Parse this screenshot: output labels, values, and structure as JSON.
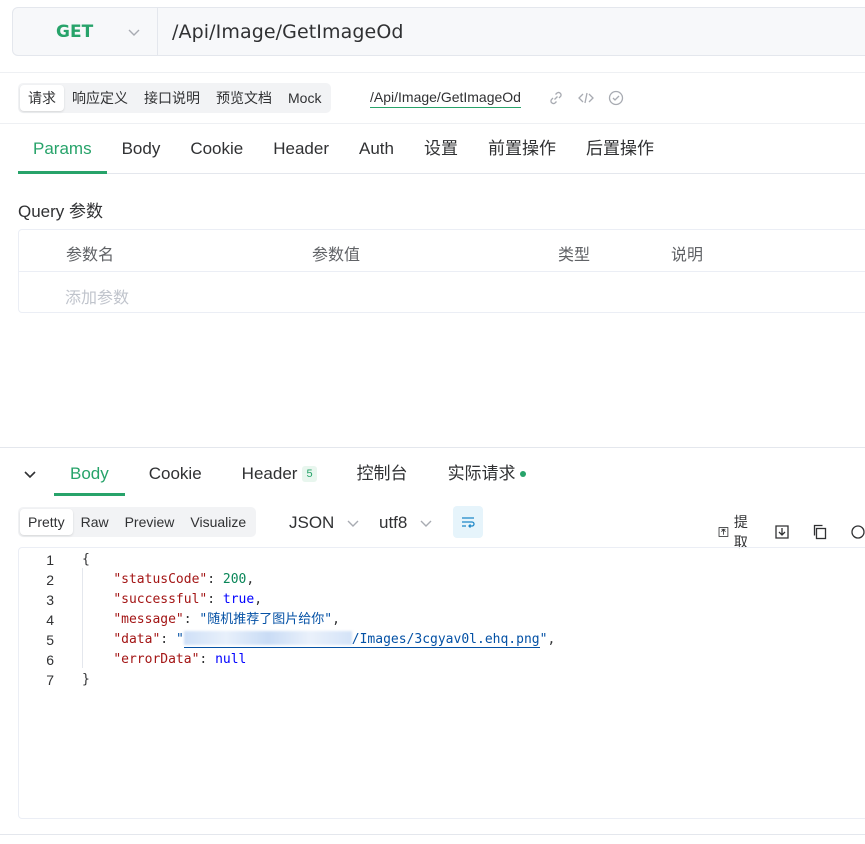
{
  "request": {
    "method": "GET",
    "url": "/Api/Image/GetImageOd"
  },
  "subbar": {
    "segments": [
      "请求",
      "响应定义",
      "接口说明",
      "预览文档",
      "Mock"
    ],
    "path": "/Api/Image/GetImageOd"
  },
  "req_tabs": [
    "Params",
    "Body",
    "Cookie",
    "Header",
    "Auth",
    "设置",
    "前置操作",
    "后置操作"
  ],
  "query": {
    "title": "Query 参数",
    "columns": [
      "参数名",
      "参数值",
      "类型",
      "说明"
    ],
    "add_placeholder": "添加参数"
  },
  "response": {
    "tabs": [
      {
        "label": "Body"
      },
      {
        "label": "Cookie"
      },
      {
        "label": "Header",
        "badge": "5"
      },
      {
        "label": "控制台"
      },
      {
        "label": "实际请求"
      }
    ],
    "view_modes": [
      "Pretty",
      "Raw",
      "Preview",
      "Visualize"
    ],
    "format": "JSON",
    "encoding": "utf8",
    "extract_label": "提取",
    "code": {
      "line_numbers": [
        "1",
        "2",
        "3",
        "4",
        "5",
        "6",
        "7"
      ],
      "open_brace": "{",
      "close_brace": "}",
      "status_key": "\"statusCode\"",
      "status_val": "200",
      "success_key": "\"successful\"",
      "success_val": "true",
      "message_key": "\"message\"",
      "message_val": "\"随机推荐了图片给你\"",
      "data_key": "\"data\"",
      "data_val_quote": "\"",
      "data_val_path": "/Images/3cgyav0l.ehq.png",
      "error_key": "\"errorData\"",
      "error_val": "null"
    }
  },
  "colors": {
    "accent": "#27a36a",
    "string": "#0451a5",
    "key": "#a31515",
    "number": "#098658"
  }
}
